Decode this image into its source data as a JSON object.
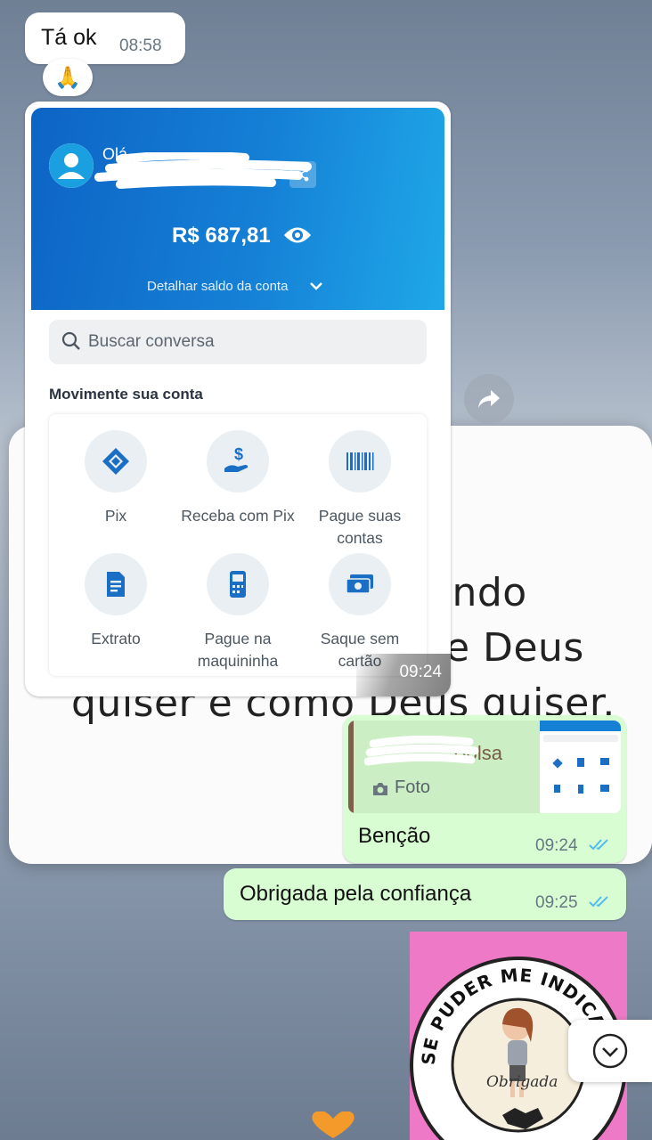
{
  "chat": {
    "incoming_text": "Tá ok",
    "incoming_time": "08:58",
    "reaction": "🙏",
    "image_time": "09:24"
  },
  "bank_screen": {
    "greeting": "Olá",
    "balance": "R$ 687,81",
    "detail_link": "Detalhar saldo da conta",
    "search_placeholder": "Buscar conversa",
    "section_title": "Movimente sua conta",
    "tiles": [
      {
        "label": "Pix",
        "icon": "pix-icon"
      },
      {
        "label": "Receba com Pix",
        "icon": "receive-money-icon"
      },
      {
        "label": "Pague suas contas",
        "icon": "barcode-icon"
      },
      {
        "label": "Extrato",
        "icon": "statement-icon"
      },
      {
        "label": "Pague na maquininha",
        "icon": "card-machine-icon"
      },
      {
        "label": "Saque sem cartão",
        "icon": "cash-withdraw-icon"
      }
    ]
  },
  "background_status": {
    "line1": "ando",
    "line2": "e Deus",
    "line3": "quiser e como Deus quiser."
  },
  "reply_message": {
    "quoted_name": "Bolsa",
    "quoted_type": "Foto",
    "text": "Benção",
    "time": "09:24"
  },
  "message2": {
    "text": "Obrigada pela confiança",
    "time": "09:25"
  },
  "sticker": {
    "ring_text": "SE PUDER ME INDICAR ME AJUDA MUITO",
    "center_text": "Obrigada"
  },
  "colors": {
    "outgoing_bubble": "#d9fdd3",
    "incoming_bubble": "#ffffff",
    "bank_blue": "#1580d6",
    "read_ticks": "#53bdeb",
    "sticker_pink": "#ee79c6"
  }
}
